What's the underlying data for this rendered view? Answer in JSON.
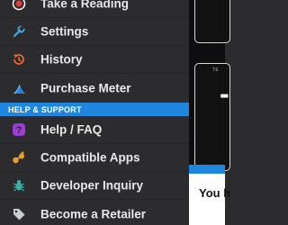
{
  "menu": {
    "items": [
      {
        "label": "Take a Reading",
        "icon": "record-icon"
      },
      {
        "label": "Settings",
        "icon": "wrench-icon"
      },
      {
        "label": "History",
        "icon": "history-icon"
      },
      {
        "label": "Purchase Meter",
        "icon": "meter-icon"
      }
    ],
    "support_header": "HELP & SUPPORT",
    "support_items": [
      {
        "label": "Help / FAQ",
        "icon": "question-icon"
      },
      {
        "label": "Compatible Apps",
        "icon": "apps-icon"
      },
      {
        "label": "Developer Inquiry",
        "icon": "bug-icon"
      },
      {
        "label": "Become a Retailer",
        "icon": "tag-icon"
      }
    ]
  },
  "right_panel": {
    "card_label": "TE",
    "card_value": "-",
    "bottom_text": "You h"
  },
  "colors": {
    "accent": "#1f86e0",
    "record": "#e53935",
    "wrench": "#4aa3df",
    "history": "#ff6b2b",
    "question": "#9b3cd6",
    "apps": "#f0a020",
    "bug": "#37b0a8",
    "tag": "#c9ccd0"
  }
}
